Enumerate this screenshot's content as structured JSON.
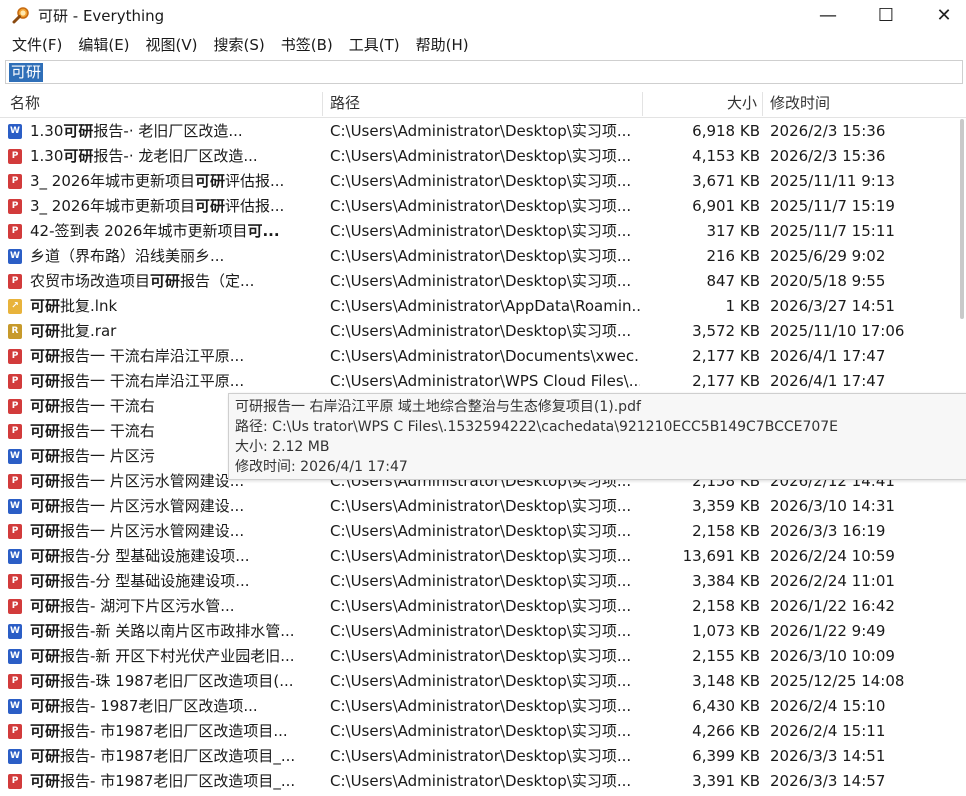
{
  "window": {
    "title": "可研 - Everything",
    "minimize": "—",
    "maximize": "☐",
    "close": "✕"
  },
  "menu": [
    "文件(F)",
    "编辑(E)",
    "视图(V)",
    "搜索(S)",
    "书签(B)",
    "工具(T)",
    "帮助(H)"
  ],
  "search": {
    "value": "可研"
  },
  "columns": {
    "name": "名称",
    "path": "路径",
    "size": "大小",
    "modified": "修改时间"
  },
  "rows": [
    {
      "icon": "doc",
      "pre": "1.30",
      "bold": "可研",
      "post": "报告-·           老旧厂区改造...",
      "path": "C:\\Users\\Administrator\\Desktop\\实习项...",
      "size": "6,918 KB",
      "date": "2026/2/3 15:36"
    },
    {
      "icon": "pdf",
      "pre": "1.30",
      "bold": "可研",
      "post": "报告-·       龙老旧厂区改造...",
      "path": "C:\\Users\\Administrator\\Desktop\\实习项...",
      "size": "4,153 KB",
      "date": "2026/2/3 15:36"
    },
    {
      "icon": "pdf",
      "pre": "3_      2026年城市更新项目",
      "bold": "可研",
      "post": "评估报...",
      "path": "C:\\Users\\Administrator\\Desktop\\实习项...",
      "size": "3,671 KB",
      "date": "2025/11/11 9:13"
    },
    {
      "icon": "pdf",
      "pre": "3_      2026年城市更新项目",
      "bold": "可研",
      "post": "评估报...",
      "path": "C:\\Users\\Administrator\\Desktop\\实习项...",
      "size": "6,901 KB",
      "date": "2025/11/7 15:19"
    },
    {
      "icon": "pdf",
      "pre": "42-签到表       2026年城市更新项目",
      "bold": "可...",
      "post": "",
      "path": "C:\\Users\\Administrator\\Desktop\\实习项...",
      "size": "317 KB",
      "date": "2025/11/7 15:11"
    },
    {
      "icon": "doc",
      "pre": "        乡道（界布路）沿线美丽乡...",
      "bold": "",
      "post": "",
      "path": "C:\\Users\\Administrator\\Desktop\\实习项...",
      "size": "216 KB",
      "date": "2025/6/29 9:02"
    },
    {
      "icon": "pdf",
      "pre": "      农贸市场改造项目",
      "bold": "可研",
      "post": "报告（定...",
      "path": "C:\\Users\\Administrator\\Desktop\\实习项...",
      "size": "847 KB",
      "date": "2020/5/18 9:55"
    },
    {
      "icon": "lnk",
      "pre": "",
      "bold": "可研",
      "post": "批复.lnk",
      "path": "C:\\Users\\Administrator\\AppData\\Roamin...",
      "size": "1 KB",
      "date": "2026/3/27 14:51"
    },
    {
      "icon": "rar",
      "pre": "",
      "bold": "可研",
      "post": "批复.rar",
      "path": "C:\\Users\\Administrator\\Desktop\\实习项...",
      "size": "3,572 KB",
      "date": "2025/11/10 17:06"
    },
    {
      "icon": "pdf",
      "pre": "",
      "bold": "可研",
      "post": "报告一           干流右岸沿江平原...",
      "path": "C:\\Users\\Administrator\\Documents\\xwec...",
      "size": "2,177 KB",
      "date": "2026/4/1 17:47"
    },
    {
      "icon": "pdf",
      "pre": "",
      "bold": "可研",
      "post": "报告一           干流右岸沿江平原...",
      "path": "C:\\Users\\Administrator\\WPS Cloud Files\\...",
      "size": "2,177 KB",
      "date": "2026/4/1 17:47"
    },
    {
      "icon": "pdf",
      "pre": "",
      "bold": "可研",
      "post": "报告一           干流右",
      "path": "",
      "size": "",
      "date": ""
    },
    {
      "icon": "pdf",
      "pre": "",
      "bold": "可研",
      "post": "报告一           干流右",
      "path": "",
      "size": "",
      "date": ""
    },
    {
      "icon": "doc",
      "pre": "",
      "bold": "可研",
      "post": "报告一           片区污",
      "path": "",
      "size": "",
      "date": ""
    },
    {
      "icon": "pdf",
      "pre": "",
      "bold": "可研",
      "post": "报告一           片区污水管网建设...",
      "path": "C:\\Users\\Administrator\\Desktop\\实习项...",
      "size": "2,158 KB",
      "date": "2026/2/12 14:41"
    },
    {
      "icon": "doc",
      "pre": "",
      "bold": "可研",
      "post": "报告一           片区污水管网建设...",
      "path": "C:\\Users\\Administrator\\Desktop\\实习项...",
      "size": "3,359 KB",
      "date": "2026/3/10 14:31"
    },
    {
      "icon": "pdf",
      "pre": "",
      "bold": "可研",
      "post": "报告一           片区污水管网建设...",
      "path": "C:\\Users\\Administrator\\Desktop\\实习项...",
      "size": "2,158 KB",
      "date": "2026/3/3 16:19"
    },
    {
      "icon": "doc",
      "pre": "",
      "bold": "可研",
      "post": "报告-分           型基础设施建设项...",
      "path": "C:\\Users\\Administrator\\Desktop\\实习项...",
      "size": "13,691 KB",
      "date": "2026/2/24 10:59"
    },
    {
      "icon": "pdf",
      "pre": "",
      "bold": "可研",
      "post": "报告-分           型基础设施建设项...",
      "path": "C:\\Users\\Administrator\\Desktop\\实习项...",
      "size": "3,384 KB",
      "date": "2026/2/24 11:01"
    },
    {
      "icon": "pdf",
      "pre": "",
      "bold": "可研",
      "post": "报告-           湖河下片区污水管...",
      "path": "C:\\Users\\Administrator\\Desktop\\实习项...",
      "size": "2,158 KB",
      "date": "2026/1/22 16:42"
    },
    {
      "icon": "doc",
      "pre": "",
      "bold": "可研",
      "post": "报告-新           关路以南片区市政排水管...",
      "path": "C:\\Users\\Administrator\\Desktop\\实习项...",
      "size": "1,073 KB",
      "date": "2026/1/22 9:49"
    },
    {
      "icon": "doc",
      "pre": "",
      "bold": "可研",
      "post": "报告-新           开区下村光伏产业园老旧...",
      "path": "C:\\Users\\Administrator\\Desktop\\实习项...",
      "size": "2,155 KB",
      "date": "2026/3/10 10:09"
    },
    {
      "icon": "pdf",
      "pre": "",
      "bold": "可研",
      "post": "报告-珠           1987老旧厂区改造项目(...",
      "path": "C:\\Users\\Administrator\\Desktop\\实习项...",
      "size": "3,148 KB",
      "date": "2025/12/25 14:08"
    },
    {
      "icon": "doc",
      "pre": "",
      "bold": "可研",
      "post": "报告-           1987老旧厂区改造项...",
      "path": "C:\\Users\\Administrator\\Desktop\\实习项...",
      "size": "6,430 KB",
      "date": "2026/2/4 15:10"
    },
    {
      "icon": "pdf",
      "pre": "",
      "bold": "可研",
      "post": "报告-           市1987老旧厂区改造项目...",
      "path": "C:\\Users\\Administrator\\Desktop\\实习项...",
      "size": "4,266 KB",
      "date": "2026/2/4 15:11"
    },
    {
      "icon": "doc",
      "pre": "",
      "bold": "可研",
      "post": "报告-           市1987老旧厂区改造项目_...",
      "path": "C:\\Users\\Administrator\\Desktop\\实习项...",
      "size": "6,399 KB",
      "date": "2026/3/3 14:51"
    },
    {
      "icon": "pdf",
      "pre": "",
      "bold": "可研",
      "post": "报告-           市1987老旧厂区改造项目_...",
      "path": "C:\\Users\\Administrator\\Desktop\\实习项...",
      "size": "3,391 KB",
      "date": "2026/3/3 14:57"
    }
  ],
  "tooltip": {
    "name": "可研报告一               右岸沿江平原          域土地综合整治与生态修复项目(1).pdf",
    "path": "路径: C:\\Us             trator\\WPS C        Files\\.1532594222\\cachedata\\921210ECC5B149C7BCCE707E",
    "size": "大小: 2.12 MB",
    "modified": "修改时间: 2026/4/1 17:47"
  }
}
